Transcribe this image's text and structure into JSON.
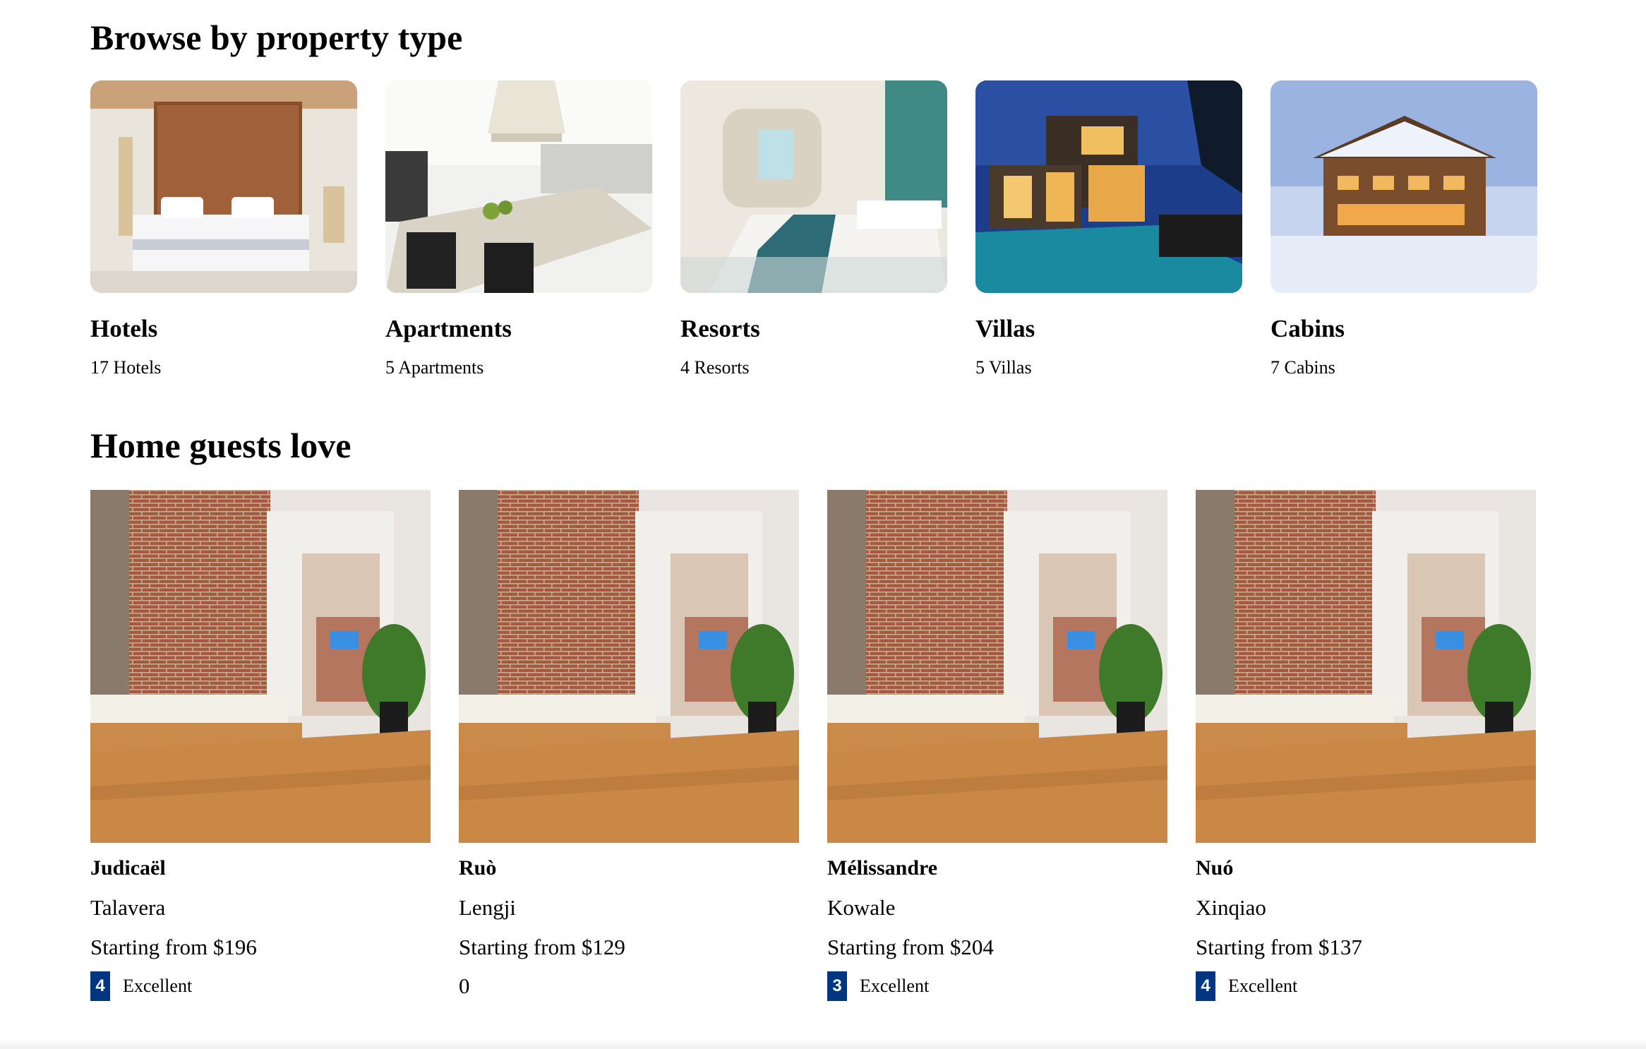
{
  "sections": {
    "property_types_title": "Browse by property type",
    "homes_title": "Home guests love"
  },
  "property_types": [
    {
      "name": "Hotels",
      "count": "17 Hotels"
    },
    {
      "name": "Apartments",
      "count": "5 Apartments"
    },
    {
      "name": "Resorts",
      "count": "4 Resorts"
    },
    {
      "name": "Villas",
      "count": "5 Villas"
    },
    {
      "name": "Cabins",
      "count": "7 Cabins"
    }
  ],
  "homes": [
    {
      "name": "Judicaël",
      "city": "Talavera",
      "price": "Starting from $196",
      "rating": "4",
      "rating_text": "Excellent"
    },
    {
      "name": "Ruò",
      "city": "Lengji",
      "price": "Starting from $129",
      "rating_plain": "0"
    },
    {
      "name": "Mélissandre",
      "city": "Kowale",
      "price": "Starting from $204",
      "rating": "3",
      "rating_text": "Excellent"
    },
    {
      "name": "Nuó",
      "city": "Xinqiao",
      "price": "Starting from $137",
      "rating": "4",
      "rating_text": "Excellent"
    }
  ],
  "colors": {
    "badge": "#003580"
  }
}
